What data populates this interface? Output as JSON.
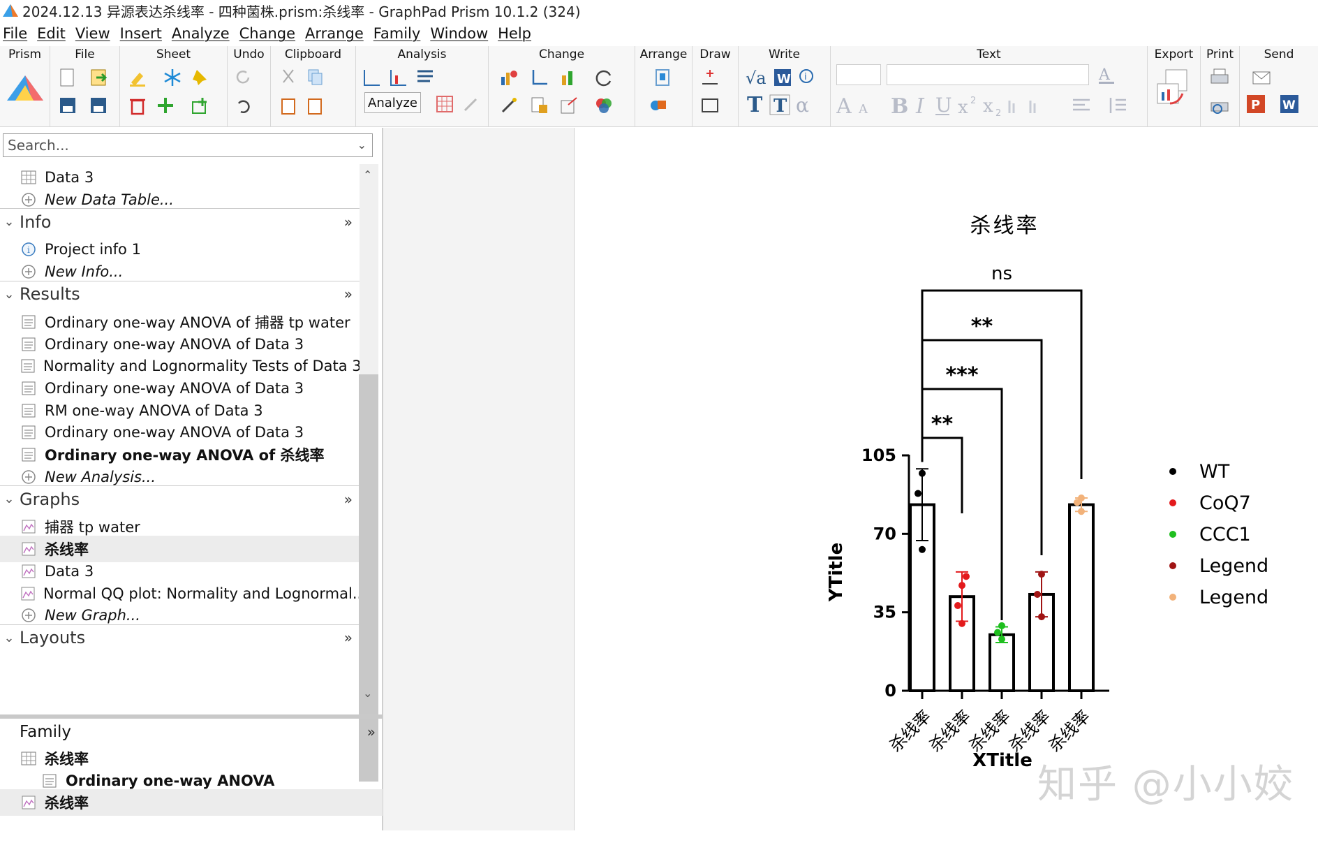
{
  "window": {
    "title": "2024.12.13 异源表达杀线率 - 四种菌株.prism:杀线率 - GraphPad Prism 10.1.2 (324)"
  },
  "menu": [
    "File",
    "Edit",
    "View",
    "Insert",
    "Analyze",
    "Change",
    "Arrange",
    "Family",
    "Window",
    "Help"
  ],
  "ribbon": {
    "groups": [
      "Prism",
      "File",
      "Sheet",
      "Undo",
      "Clipboard",
      "Analysis",
      "Change",
      "Arrange",
      "Draw",
      "Write",
      "Text",
      "Export",
      "Print",
      "Send"
    ],
    "analyze_label": "Analyze"
  },
  "navigator": {
    "search_placeholder": "Search...",
    "rows": [
      {
        "kind": "item",
        "icon": "data-table-icon",
        "label": "Data 3"
      },
      {
        "kind": "new",
        "icon": "plus-circle-icon",
        "label": "New Data Table..."
      },
      {
        "kind": "section",
        "label": "Info"
      },
      {
        "kind": "item",
        "icon": "info-icon",
        "label": "Project info 1"
      },
      {
        "kind": "new",
        "icon": "plus-circle-icon",
        "label": "New Info..."
      },
      {
        "kind": "section",
        "label": "Results"
      },
      {
        "kind": "item",
        "icon": "results-icon",
        "label": "Ordinary one-way ANOVA of 捕器 tp water"
      },
      {
        "kind": "item",
        "icon": "results-icon",
        "label": "Ordinary one-way ANOVA of Data 3"
      },
      {
        "kind": "item",
        "icon": "results-icon",
        "label": "Normality and Lognormality Tests of Data 3"
      },
      {
        "kind": "item",
        "icon": "results-icon",
        "label": "Ordinary one-way ANOVA of Data 3"
      },
      {
        "kind": "item",
        "icon": "results-icon",
        "label": "RM one-way ANOVA of Data 3"
      },
      {
        "kind": "item",
        "icon": "results-icon",
        "label": "Ordinary one-way ANOVA of Data 3"
      },
      {
        "kind": "item",
        "icon": "results-icon",
        "label": "Ordinary one-way ANOVA of 杀线率",
        "bold": true
      },
      {
        "kind": "new",
        "icon": "plus-circle-icon",
        "label": "New Analysis..."
      },
      {
        "kind": "section",
        "label": "Graphs"
      },
      {
        "kind": "item",
        "icon": "graph-icon",
        "label": "捕器 tp water"
      },
      {
        "kind": "item",
        "icon": "graph-icon",
        "label": "杀线率",
        "bold": true,
        "selected": true
      },
      {
        "kind": "item",
        "icon": "graph-icon",
        "label": "Data 3"
      },
      {
        "kind": "item",
        "icon": "graph-icon",
        "label": "Normal QQ plot: Normality and Lognormal..."
      },
      {
        "kind": "new",
        "icon": "plus-circle-icon",
        "label": "New Graph..."
      },
      {
        "kind": "section",
        "label": "Layouts"
      }
    ],
    "family": {
      "title": "Family",
      "rows": [
        {
          "kind": "item",
          "icon": "data-table-icon",
          "label": "杀线率",
          "bold": true
        },
        {
          "kind": "sub",
          "icon": "results-icon",
          "label": "Ordinary one-way ANOVA",
          "bold": true
        },
        {
          "kind": "item",
          "icon": "graph-icon",
          "label": "杀线率",
          "bold": true,
          "selected": true
        }
      ]
    }
  },
  "chart_data": {
    "type": "bar",
    "title": "杀线率",
    "xlabel": "XTitle",
    "ylabel": "YTitle",
    "ylim": [
      0,
      105
    ],
    "yticks": [
      0,
      35,
      70,
      105
    ],
    "categories": [
      "杀线率",
      "杀线率",
      "杀线率",
      "杀线率",
      "杀线率"
    ],
    "series": [
      {
        "name": "WT",
        "color": "#000000",
        "mean": 83,
        "error": 16,
        "points": [
          63,
          88,
          97
        ]
      },
      {
        "name": "CoQ7",
        "color": "#e31a1c",
        "mean": 42,
        "error": 11,
        "points": [
          30,
          38,
          47,
          51
        ]
      },
      {
        "name": "CCC1",
        "color": "#1fbf1f",
        "mean": 25,
        "error": 3.5,
        "points": [
          23,
          26,
          29
        ]
      },
      {
        "name": "Legend",
        "color": "#a01414",
        "mean": 43,
        "error": 10,
        "points": [
          33,
          43,
          52
        ]
      },
      {
        "name": "Legend",
        "color": "#f2b27a",
        "mean": 83,
        "error": 3,
        "points": [
          80,
          84,
          86
        ]
      }
    ],
    "comparisons": [
      {
        "from": 0,
        "to": 1,
        "label": "**"
      },
      {
        "from": 0,
        "to": 2,
        "label": "***"
      },
      {
        "from": 0,
        "to": 3,
        "label": "**"
      },
      {
        "from": 0,
        "to": 4,
        "label": "ns"
      }
    ],
    "legend_placement": "right"
  },
  "watermark": "知乎 @小小姣"
}
